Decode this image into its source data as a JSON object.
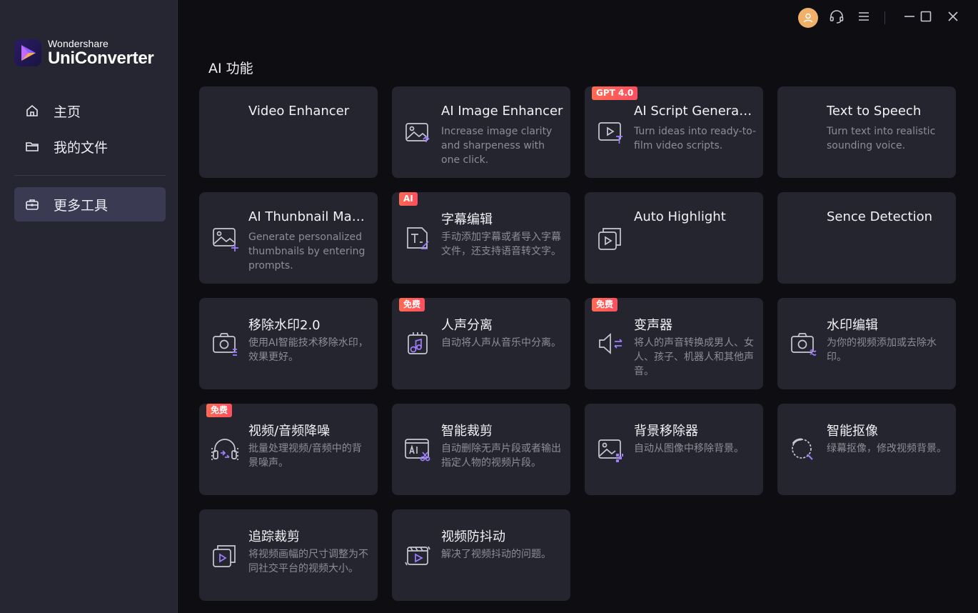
{
  "app": {
    "brand_sub": "Wondershare",
    "brand_main": "UniConverter"
  },
  "sidebar": {
    "items": [
      {
        "label": "主页",
        "icon": "home-icon",
        "active": false
      },
      {
        "label": "我的文件",
        "icon": "folder-icon",
        "active": false
      },
      {
        "label": "更多工具",
        "icon": "toolbox-icon",
        "active": true
      }
    ]
  },
  "topbar": {
    "icons": [
      "user-avatar-icon",
      "headset-icon",
      "menu-icon",
      "minimize-icon",
      "maximize-icon",
      "close-icon"
    ]
  },
  "section": {
    "title": "AI 功能"
  },
  "tools": [
    {
      "title": "Video Enhancer",
      "desc": "",
      "badge": "",
      "icon": "none"
    },
    {
      "title": "AI Image Enhancer",
      "desc": "Increase image clarity and sharpeness with one click.",
      "badge": "",
      "icon": "image-enhance-icon"
    },
    {
      "title": "AI Script Generator",
      "desc": "Turn ideas into ready-to-film video scripts.",
      "badge": "GPT 4.0",
      "icon": "script-icon"
    },
    {
      "title": "Text to Speech",
      "desc": "Turn text into realistic sounding voice.",
      "badge": "",
      "icon": "none"
    },
    {
      "title": "AI Thunbnail Maker",
      "desc": "Generate personalized thumbnails by entering prompts.",
      "badge": "",
      "icon": "thumbnail-icon"
    },
    {
      "title": "字幕编辑",
      "desc": "手动添加字幕或者导入字幕文件，还支持语音转文字。",
      "badge": "AI",
      "icon": "subtitle-icon"
    },
    {
      "title": "Auto Highlight",
      "desc": "",
      "badge": "",
      "icon": "highlight-icon"
    },
    {
      "title": "Sence Detection",
      "desc": "",
      "badge": "",
      "icon": "none"
    },
    {
      "title": "移除水印2.0",
      "desc": "使用AI智能技术移除水印，效果更好。",
      "badge": "",
      "icon": "watermark-remove-icon"
    },
    {
      "title": "人声分离",
      "desc": "自动将人声从音乐中分离。",
      "badge": "免费",
      "icon": "vocal-separate-icon"
    },
    {
      "title": "变声器",
      "desc": "将人的声音转换成男人、女人、孩子、机器人和其他声音。",
      "badge": "免费",
      "icon": "voice-changer-icon"
    },
    {
      "title": "水印编辑",
      "desc": "为你的视频添加或去除水印。",
      "badge": "",
      "icon": "watermark-edit-icon"
    },
    {
      "title": "视频/音频降噪",
      "desc": "批量处理视频/音频中的背景噪声。",
      "badge": "免费",
      "icon": "denoise-icon"
    },
    {
      "title": "智能裁剪",
      "desc": "自动删除无声片段或者输出指定人物的视频片段。",
      "badge": "",
      "icon": "ai-cut-icon"
    },
    {
      "title": "背景移除器",
      "desc": "自动从图像中移除背景。",
      "badge": "",
      "icon": "bg-remove-icon"
    },
    {
      "title": "智能抠像",
      "desc": "绿幕抠像，修改视频背景。",
      "badge": "",
      "icon": "smart-cutout-icon"
    },
    {
      "title": "追踪裁剪",
      "desc": "将视频画幅的尺寸调整为不同社交平台的视频大小。",
      "badge": "",
      "icon": "track-crop-icon"
    },
    {
      "title": "视频防抖动",
      "desc": "解决了视频抖动的问题。",
      "badge": "",
      "icon": "stabilize-icon"
    }
  ]
}
